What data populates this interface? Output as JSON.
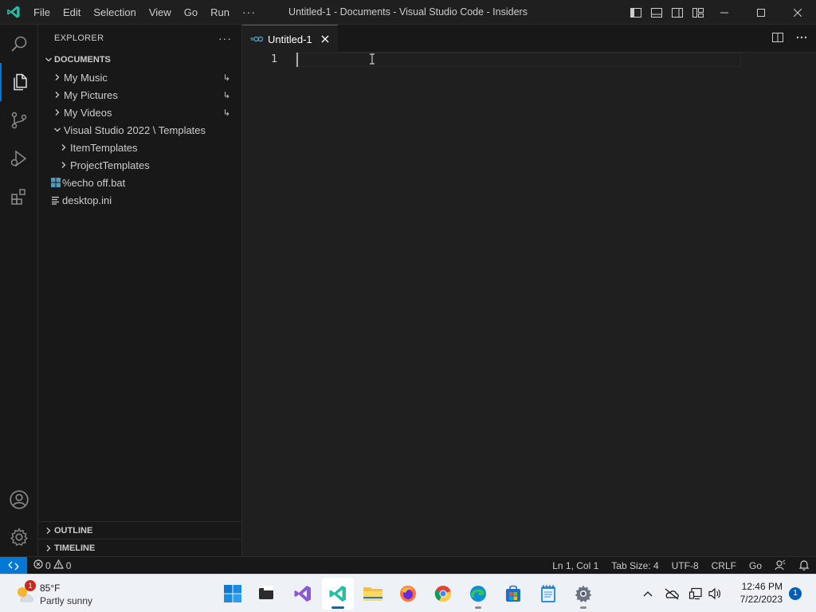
{
  "window": {
    "title": "Untitled-1 - Documents - Visual Studio Code - Insiders"
  },
  "menu": {
    "items": [
      "File",
      "Edit",
      "Selection",
      "View",
      "Go",
      "Run"
    ],
    "more": "···"
  },
  "sidebar": {
    "title": "EXPLORER",
    "more": "···",
    "root_folder": "DOCUMENTS",
    "items": [
      {
        "label": "My Music",
        "kind": "folder",
        "badge": "↳"
      },
      {
        "label": "My Pictures",
        "kind": "folder",
        "badge": "↳"
      },
      {
        "label": "My Videos",
        "kind": "folder",
        "badge": "↳"
      },
      {
        "label": "Visual Studio 2022 \\ Templates",
        "kind": "folder-open"
      },
      {
        "label": "ItemTemplates",
        "kind": "folder"
      },
      {
        "label": "ProjectTemplates",
        "kind": "folder"
      },
      {
        "label": "%echo off.bat",
        "kind": "bat-file"
      },
      {
        "label": "desktop.ini",
        "kind": "ini-file"
      }
    ],
    "outline": "OUTLINE",
    "timeline": "TIMELINE"
  },
  "editor": {
    "tab_label": "Untitled-1",
    "line_number": "1"
  },
  "statusbar": {
    "errors": "0",
    "warnings": "0",
    "position": "Ln 1, Col 1",
    "tab_size": "Tab Size: 4",
    "encoding": "UTF-8",
    "eol": "CRLF",
    "language": "Go"
  },
  "taskbar": {
    "weather_temp": "85°F",
    "weather_desc": "Partly sunny",
    "weather_badge": "1",
    "time": "12:46 PM",
    "date": "7/22/2023",
    "notification_count": "1",
    "apps": [
      "start-icon",
      "terminal-icon",
      "visual-studio-icon",
      "vscode-insiders-icon",
      "file-explorer-icon",
      "firefox-icon",
      "chrome-icon",
      "edge-icon",
      "microsoft-store-icon",
      "notepad-icon",
      "settings-icon"
    ]
  },
  "colors": {
    "accent": "#0078d4",
    "background": "#1f1f1f",
    "sidebar": "#181818",
    "vscode_insiders": "#24bfa5"
  }
}
